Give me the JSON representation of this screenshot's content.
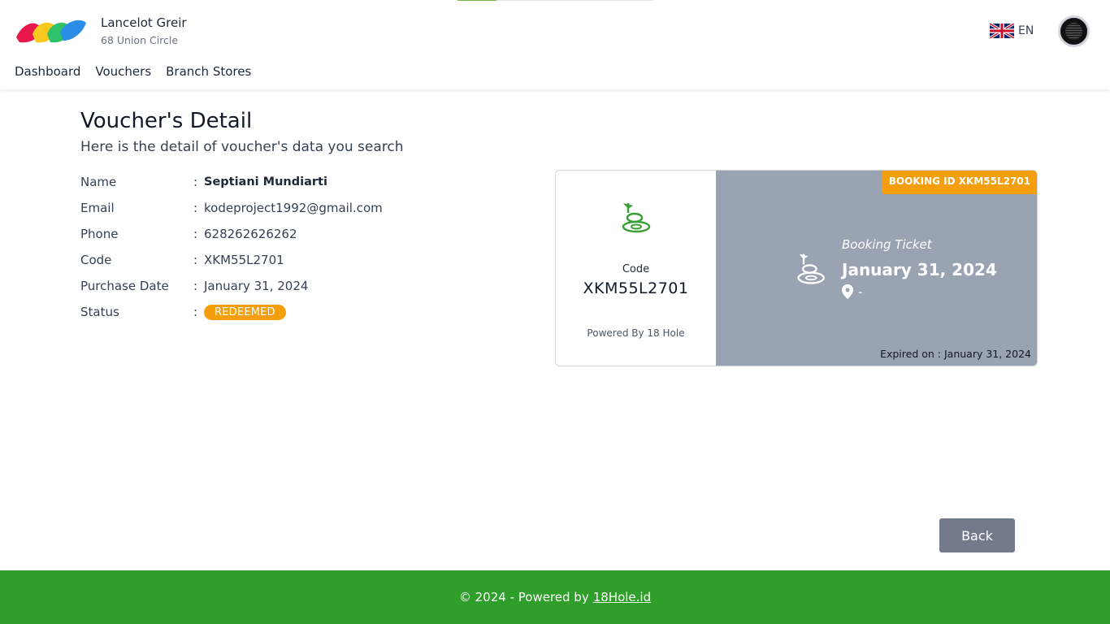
{
  "header": {
    "org_name": "Lancelot Greir",
    "org_address": "68 Union Circle",
    "nav": [
      "Dashboard",
      "Vouchers",
      "Branch Stores"
    ],
    "language": "EN",
    "logo_colors": [
      "#e8174a",
      "#f7c81e",
      "#2ec26a",
      "#2b8ee6"
    ]
  },
  "main": {
    "title": "Voucher's Detail",
    "subtitle": "Here is the detail of voucher's data you search",
    "details": [
      {
        "label": "Name",
        "value": "Septiani Mundiarti"
      },
      {
        "label": "Email",
        "value": "kodeproject1992@gmail.com"
      },
      {
        "label": "Phone",
        "value": "628262626262"
      },
      {
        "label": "Code",
        "value": "XKM55L2701"
      },
      {
        "label": "Purchase Date",
        "value": "January 31, 2024"
      },
      {
        "label": "Status",
        "value": "REDEEMED"
      }
    ],
    "colon": ":"
  },
  "ticket": {
    "code_label": "Code",
    "code_value": "XKM55L2701",
    "powered_by": "Powered By 18 Hole",
    "booking_id": "BOOKING ID XKM55L2701",
    "ticket_type": "Booking Ticket",
    "date": "January 31, 2024",
    "location": "-",
    "expired": "Expired on : January 31, 2024"
  },
  "actions": {
    "back_label": "Back"
  },
  "footer": {
    "text": "© 2024 - Powered by",
    "link_text": "18Hole.id"
  },
  "colors": {
    "accent_orange": "#f59e0b",
    "footer_green": "#2f9e2b",
    "ticket_gray": "#9aa3b2",
    "button_gray": "#737a8c",
    "golf_green": "#3aa035"
  }
}
